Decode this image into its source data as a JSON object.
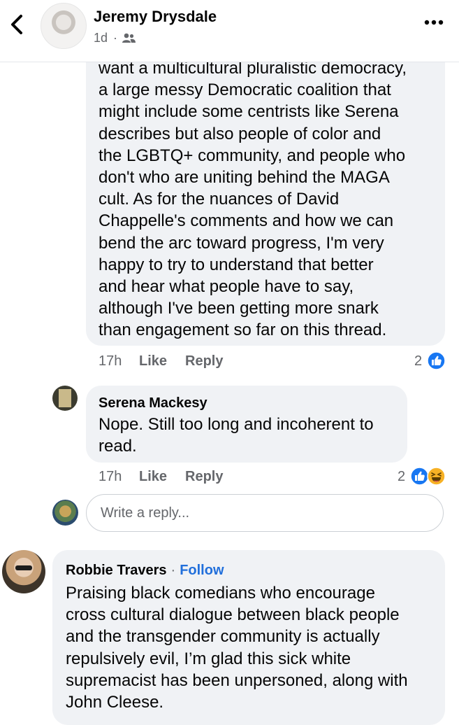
{
  "header": {
    "author_name": "Jeremy Drysdale",
    "post_time": "1d",
    "separator": "·"
  },
  "comments": [
    {
      "text": "want a multicultural pluralistic democracy,\na large messy Democratic coalition that\nmight include some centrists like Serena\ndescribes but also people of color and\nthe LGBTQ+ community, and people who\ndon't who are uniting behind the MAGA\ncult.  As for the nuances of David\nChappelle's comments and how we can\nbend the arc toward progress, I'm very\nhappy to try to understand that better\nand hear what people have to say,\nalthough I've been getting more snark\nthan engagement so far on this thread.",
      "time": "17h",
      "like_label": "Like",
      "reply_label": "Reply",
      "reaction_count": "2"
    },
    {
      "author": "Serena Mackesy",
      "text": "Nope. Still too long and incoherent to\nread.",
      "time": "17h",
      "like_label": "Like",
      "reply_label": "Reply",
      "reaction_count": "2"
    },
    {
      "author": "Robbie Travers",
      "follow_label": "Follow",
      "separator": "·",
      "text": "Praising black comedians who encourage\ncross cultural dialogue between black people\nand the transgender community is actually\nrepulsively evil, I’m glad this sick white\nsupremacist has been unpersoned, along with\nJohn Cleese."
    }
  ],
  "reply_box": {
    "placeholder": "Write a reply..."
  },
  "colors": {
    "bubble_bg": "#f0f2f5",
    "meta_text": "#65676b",
    "like_blue": "#1877f2",
    "follow_blue": "#216fdb",
    "haha_yellow": "#f7b125"
  },
  "icons": [
    "back-chevron-icon",
    "group-audience-icon",
    "more-dots-icon",
    "like-reaction-icon",
    "haha-reaction-icon"
  ]
}
